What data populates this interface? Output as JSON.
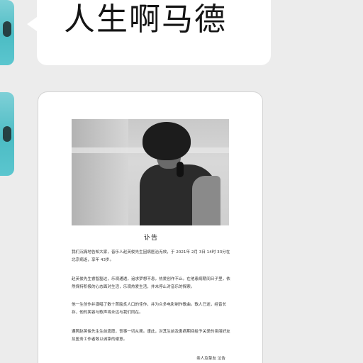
{
  "chat": {
    "message_text": "人生啊马德",
    "document": {
      "title": "讣告",
      "paragraphs": [
        "我们沉痛地告知大家，音乐人赵英俊先生因病医治无效，于 2021年 2月 3日 14时 33分在北京病逝，享年 43岁。",
        "赵英俊先生睿智豁达，乐观通透，追求梦想不息，热爱创作不止。在他患病期间日子里，依然保持积极的心态面对生活，乐观热爱生活，并未停止对音乐的探索。",
        "他一生创作并演唱了数十首脍炙人口的佳作，并为众多电影制作歌曲。歌人已逝，经音长存，他的笑容与歌声将永远与我们同在。",
        "遵照赵英俊先生生前遗愿，丧事一切从简。谨此，对其生前及患病期间给予关爱的亲朋好友及医务工作者致以诚挚的谢意。"
      ],
      "signoff": "亲人及挚友  泣告"
    }
  },
  "colors": {
    "background": "#ececec",
    "bubble": "#ffffff",
    "avatar_teal": "#4cbcc4"
  }
}
